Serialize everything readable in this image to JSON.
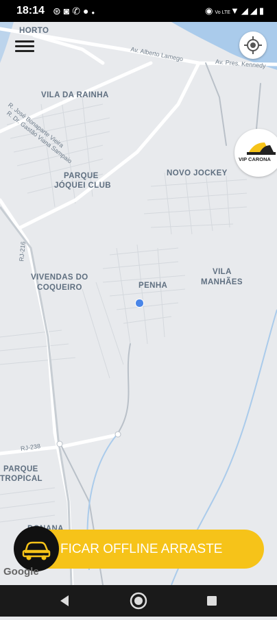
{
  "status_bar": {
    "time": "18:14",
    "left_icons": [
      "chrome-icon",
      "instagram-icon",
      "whatsapp-icon",
      "dot-icon",
      "dot-icon"
    ],
    "right_icons": [
      "eye-icon",
      "volte-icon",
      "wifi-icon",
      "signal-icon",
      "signal-icon",
      "battery-icon"
    ],
    "volte_label": "Vo LTE"
  },
  "map": {
    "labels": {
      "horto": "HORTO",
      "vila_rainha": "VILA DA RAINHA",
      "parque_joquei_l1": "PARQUE",
      "parque_joquei_l2": "JÓQUEI CLUB",
      "novo_jockey": "NOVO JOCKEY",
      "vivendas_l1": "VIVENDAS DO",
      "vivendas_l2": "COQUEIRO",
      "penha": "PENHA",
      "vila_manhaes_l1": "VILA",
      "vila_manhaes_l2": "MANHÃES",
      "parque_tropical_l1": "PARQUE",
      "parque_tropical_l2": "TROPICAL",
      "donana": "DONANA"
    },
    "roads": {
      "alberto_lamego": "Av. Alberto Lamego",
      "pres_kennedy": "Av. Pres. Kennedy",
      "gastao": "R. Dr. Gastão Viana Sampaio",
      "jose_bonaparte": "R. José Bonaparte Vieira",
      "rj216": "RJ-216",
      "rj238": "RJ-238"
    },
    "water_color": "#aacbeb",
    "land_color": "#e8eaed"
  },
  "brand": {
    "label": "VIP CARONA",
    "accent": "#f6c319"
  },
  "slider": {
    "label": "FICAR OFFLINE ARRASTE",
    "color": "#f6c319"
  },
  "attribution": "Google",
  "nav": {
    "back": "back-icon",
    "home": "home-icon",
    "recents": "recents-icon"
  }
}
